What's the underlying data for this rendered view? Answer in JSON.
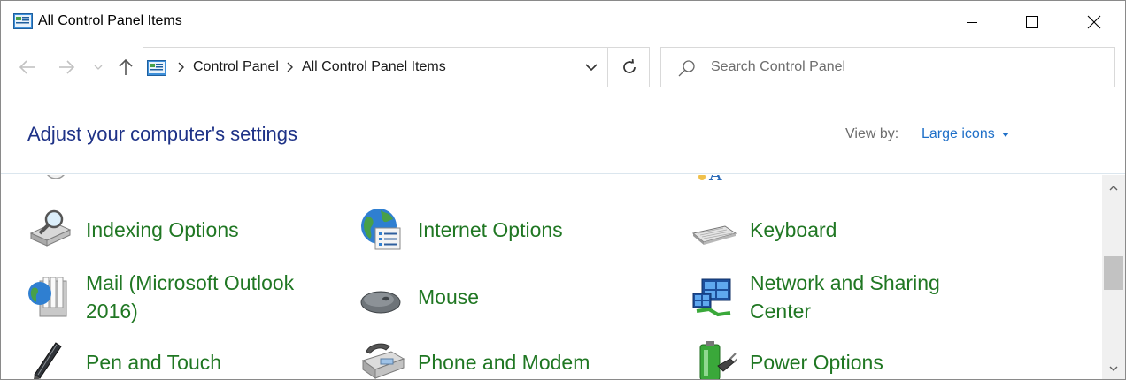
{
  "window": {
    "title": "All Control Panel Items",
    "controls": {
      "minimize": "minimize",
      "maximize": "maximize",
      "close": "close"
    }
  },
  "nav": {
    "back_icon": "arrow-left-icon",
    "forward_icon": "arrow-right-icon",
    "recent_icon": "chevron-down-icon",
    "up_icon": "arrow-up-icon"
  },
  "address": {
    "crumbs": [
      "Control Panel",
      "All Control Panel Items"
    ],
    "refresh_icon": "refresh-icon"
  },
  "search": {
    "placeholder": "Search Control Panel"
  },
  "header": {
    "title": "Adjust your computer's settings",
    "view_by_label": "View by:",
    "view_by_value": "Large icons"
  },
  "items": [
    {
      "label": "Indexing Options",
      "icon": "indexing-options-icon"
    },
    {
      "label": "Internet Options",
      "icon": "internet-options-icon"
    },
    {
      "label": "Keyboard",
      "icon": "keyboard-icon"
    },
    {
      "label": "Mail (Microsoft Outlook 2016)",
      "label_line1": "Mail (Microsoft Outlook",
      "label_line2": "2016)",
      "icon": "mail-icon"
    },
    {
      "label": "Mouse",
      "icon": "mouse-icon"
    },
    {
      "label": "Network and Sharing Center",
      "label_line1": "Network and Sharing",
      "label_line2": "Center",
      "icon": "network-sharing-icon"
    },
    {
      "label": "Pen and Touch",
      "icon": "pen-icon"
    },
    {
      "label": "Phone and Modem",
      "icon": "phone-modem-icon"
    },
    {
      "label": "Power Options",
      "icon": "power-options-icon"
    }
  ],
  "colors": {
    "link_green": "#207723",
    "title_blue": "#1e3287",
    "accent_blue": "#1e6fc8"
  }
}
